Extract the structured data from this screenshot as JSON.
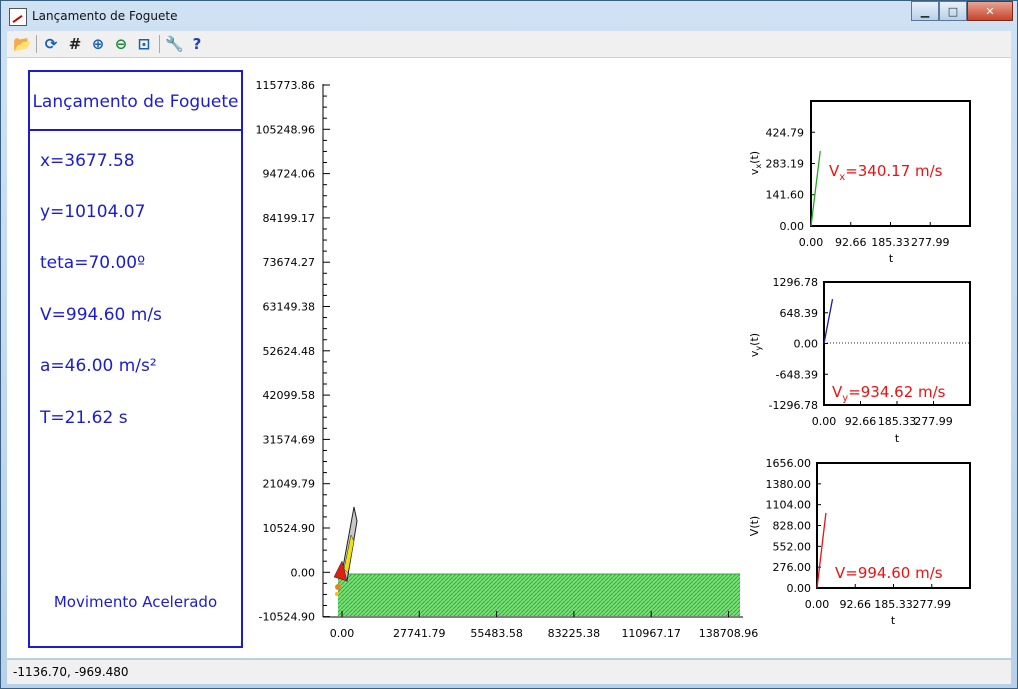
{
  "window": {
    "title": "Lançamento de Foguete",
    "minimize": "▁",
    "maximize": "□",
    "close": "✕"
  },
  "toolbar": [
    {
      "name": "open-icon",
      "glyph": "📂",
      "color": "#b07a10"
    },
    {
      "name": "refresh-icon",
      "glyph": "⟳",
      "color": "#1a5fb4"
    },
    {
      "name": "grid-icon",
      "glyph": "#",
      "color": "#222222"
    },
    {
      "name": "zoom-in-icon",
      "glyph": "⊕",
      "color": "#1a5fb4"
    },
    {
      "name": "zoom-out-icon",
      "glyph": "⊖",
      "color": "#1a8a3a"
    },
    {
      "name": "zoom-fit-icon",
      "glyph": "⊡",
      "color": "#1a5fb4"
    },
    {
      "name": "settings-wrench-icon",
      "glyph": "🔧",
      "color": "#b07a10"
    },
    {
      "name": "help-icon",
      "glyph": "?",
      "color": "#1a3fb4"
    }
  ],
  "panel": {
    "title": "Lançamento de Foguete",
    "x": "x=3677.58",
    "y": "y=10104.07",
    "teta": "teta=70.00º",
    "v": "V=994.60 m/s",
    "a": "a=46.00 m/s²",
    "t": "T=21.62 s",
    "mode": "Movimento Acelerado"
  },
  "main_plot": {
    "y_ticks": [
      "115773.86",
      "105248.96",
      "94724.06",
      "84199.17",
      "73674.27",
      "63149.38",
      "52624.48",
      "42099.58",
      "31574.69",
      "21049.79",
      "10524.90",
      "0.00",
      "-10524.90"
    ],
    "x_ticks": [
      "0.00",
      "27741.79",
      "55483.58",
      "83225.38",
      "110967.17",
      "138708.96"
    ]
  },
  "charts": {
    "vx": {
      "ylabel": "vx(t)",
      "xlabel": "t",
      "y_ticks": [
        "424.79",
        "283.19",
        "141.60",
        "0.00"
      ],
      "x_ticks": [
        "0.00",
        "92.66",
        "185.33",
        "277.99"
      ],
      "readout": "Vx=340.17 m/s"
    },
    "vy": {
      "ylabel": "vy(t)",
      "xlabel": "t",
      "y_ticks": [
        "1296.78",
        "648.39",
        "0.00",
        "-648.39",
        "-1296.78"
      ],
      "x_ticks": [
        "0.00",
        "92.66",
        "185.33",
        "277.99"
      ],
      "readout": "Vy=934.62 m/s"
    },
    "v": {
      "ylabel": "V(t)",
      "xlabel": "t",
      "y_ticks": [
        "1656.00",
        "1380.00",
        "1104.00",
        "828.00",
        "552.00",
        "276.00",
        "0.00"
      ],
      "x_ticks": [
        "0.00",
        "92.66",
        "185.33",
        "277.99"
      ],
      "readout": "V=994.60 m/s"
    }
  },
  "chart_data": [
    {
      "type": "line",
      "title": "",
      "xlabel": "t",
      "ylabel": "vx(t)",
      "ylim": [
        0,
        566.39
      ],
      "xlim": [
        0,
        370.66
      ],
      "series": [
        {
          "x": [
            0,
            21.62
          ],
          "y": [
            0,
            340.17
          ],
          "color": "#22aa22"
        }
      ]
    },
    {
      "type": "line",
      "title": "",
      "xlabel": "t",
      "ylabel": "vy(t)",
      "ylim": [
        -1296.78,
        1296.78
      ],
      "xlim": [
        0,
        370.66
      ],
      "series": [
        {
          "x": [
            0,
            21.62
          ],
          "y": [
            0,
            934.62
          ],
          "color": "#1b1b9a"
        }
      ]
    },
    {
      "type": "line",
      "title": "",
      "xlabel": "t",
      "ylabel": "V(t)",
      "ylim": [
        0,
        1656
      ],
      "xlim": [
        0,
        370.66
      ],
      "series": [
        {
          "x": [
            0,
            21.62
          ],
          "y": [
            0,
            994.6
          ],
          "color": "#ee1111"
        }
      ]
    }
  ],
  "status": {
    "coords": "-1136.70, -969.480"
  }
}
